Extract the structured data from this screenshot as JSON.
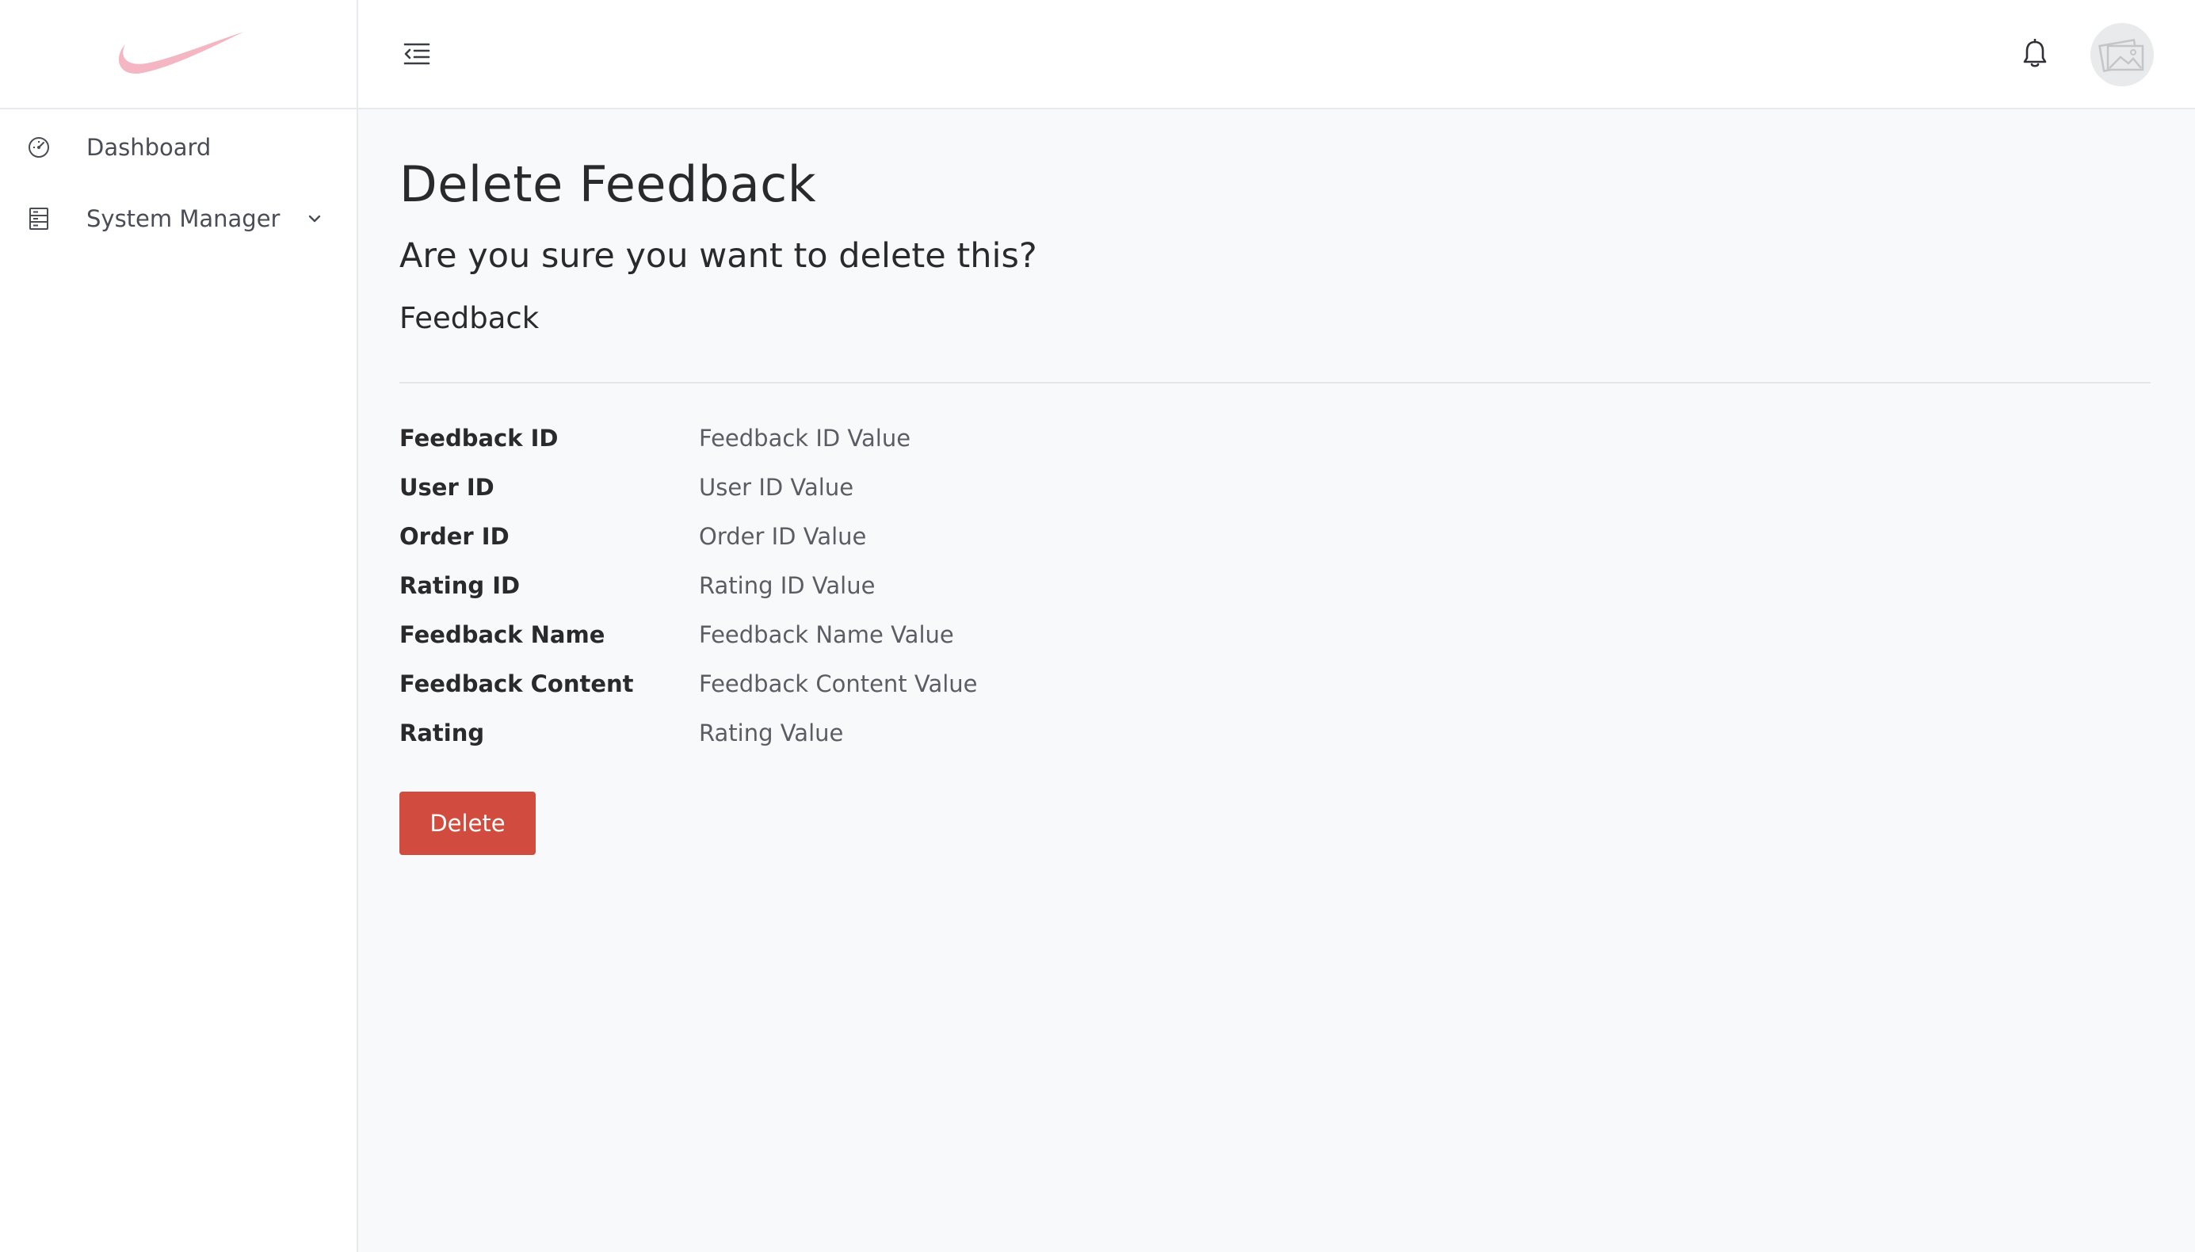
{
  "sidebar": {
    "logo_icon": "swoosh-logo",
    "items": [
      {
        "label": "Dashboard",
        "icon": "gauge-icon"
      },
      {
        "label": "System Manager",
        "icon": "server-icon",
        "chevron": "chevron-down-icon"
      }
    ]
  },
  "topbar": {
    "menu_icon": "menu-collapse-icon",
    "notification_icon": "bell-icon",
    "avatar_icon": "image-placeholder-icon"
  },
  "main": {
    "title": "Delete Feedback",
    "confirm_text": "Are you sure you want to delete this?",
    "entity_name": "Feedback",
    "fields": [
      {
        "label": "Feedback ID",
        "value": "Feedback ID Value"
      },
      {
        "label": "User ID",
        "value": "User ID Value"
      },
      {
        "label": "Order ID",
        "value": "Order ID Value"
      },
      {
        "label": "Rating ID",
        "value": "Rating ID Value"
      },
      {
        "label": "Feedback Name",
        "value": "Feedback Name Value"
      },
      {
        "label": "Feedback Content",
        "value": "Feedback Content Value"
      },
      {
        "label": "Rating",
        "value": "Rating Value"
      }
    ],
    "delete_label": "Delete"
  },
  "colors": {
    "accent_danger": "#d14b3e",
    "logo": "#f4b6c2",
    "sidebar_bg": "#ffffff",
    "main_bg": "#f8f9fb"
  }
}
